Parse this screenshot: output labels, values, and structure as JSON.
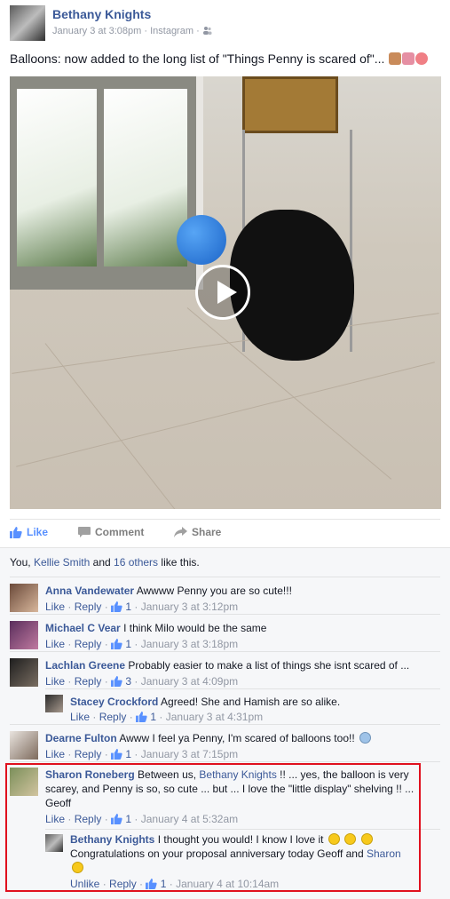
{
  "post": {
    "author": "Bethany Knights",
    "date": "January 3 at 3:08pm",
    "source": "Instagram",
    "caption": "Balloons: now added to the long list of \"Things Penny is scared of\"...",
    "caption_emojis": [
      "dog-face-icon",
      "broken-heart-icon",
      "balloon-icon"
    ]
  },
  "actions": {
    "like": "Like",
    "comment": "Comment",
    "share": "Share"
  },
  "likes": {
    "prefix": "You,",
    "person": "Kellie Smith",
    "middle": "and",
    "others": "16 others",
    "suffix": "like this."
  },
  "comments": [
    {
      "name": "Anna Vandewater",
      "text": "Awwww Penny you are so cute!!!",
      "like": "Like",
      "reply": "Reply",
      "count": "1",
      "time": "January 3 at 3:12pm"
    },
    {
      "name": "Michael C Vear",
      "text": "I think Milo would be the same",
      "like": "Like",
      "reply": "Reply",
      "count": "1",
      "time": "January 3 at 3:18pm"
    },
    {
      "name": "Lachlan Greene",
      "text": "Probably easier to make a list of things she isnt scared of ...",
      "like": "Like",
      "reply": "Reply",
      "count": "3",
      "time": "January 3 at 4:09pm"
    },
    {
      "name": "Stacey Crockford",
      "text": "Agreed! She and Hamish are so alike.",
      "like": "Like",
      "reply": "Reply",
      "count": "1",
      "time": "January 3 at 4:31pm"
    },
    {
      "name": "Dearne Fulton",
      "text": "Awww I feel ya Penny, I'm scared of balloons too!!",
      "like": "Like",
      "reply": "Reply",
      "count": "1",
      "time": "January 3 at 7:15pm"
    },
    {
      "name": "Sharon Roneberg",
      "text_a": "Between us,",
      "mention": "Bethany Knights",
      "text_b": "!! ... yes, the balloon is very scarey, and Penny is so, so cute ... but ... I love the \"little display\" shelving !! ... Geoff",
      "like": "Like",
      "reply": "Reply",
      "count": "1",
      "time": "January 4 at 5:32am"
    },
    {
      "name": "Bethany Knights",
      "text_a": "I thought you would! I know I love it",
      "text_b": "Congratulations on your proposal anniversary today Geoff and",
      "mention": "Sharon",
      "like": "Unlike",
      "reply": "Reply",
      "count": "1",
      "time": "January 4 at 10:14am"
    }
  ],
  "colors": {
    "link": "#3b5998",
    "meta": "#9197a3",
    "highlight": "#e0101e",
    "feedback_bg": "#f6f7f9"
  }
}
